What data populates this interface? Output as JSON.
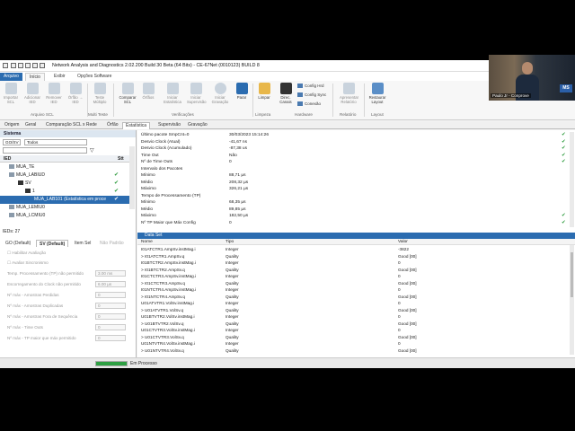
{
  "window": {
    "title": "Network Analysis and Diagnostics 2.02.200 Build 30 Beta (64 Bits) - CE-67Net (0010123)  BUILD 8"
  },
  "ribbon_tabs": [
    "Arquivo",
    "Início",
    "Exibir",
    "Opções Software"
  ],
  "ribbon": {
    "buttons": [
      {
        "label": "Importar SCL"
      },
      {
        "label": "Adicionar IED"
      },
      {
        "label": "Remover IED"
      },
      {
        "label": "Órfão → IED"
      },
      {
        "label": "Teste Múltiplo"
      },
      {
        "label": "Comparar SCL"
      },
      {
        "label": "Órfãos"
      },
      {
        "label": "Iniciar Estatística"
      },
      {
        "label": "Iniciar Supervisão"
      },
      {
        "label": "Iniciar Gravação"
      },
      {
        "label": "Parar"
      },
      {
        "label": "Limpar"
      },
      {
        "label": "Direc. Canais"
      },
      {
        "label": "Apresentar Relatório"
      },
      {
        "label": "Restaurar Layout"
      }
    ],
    "small_buttons": [
      "Config Hrd",
      "Config Sync",
      "Conexão"
    ],
    "groups": [
      "Arquivo SCL",
      "Multi Teste",
      "Verificações",
      "Limpeza",
      "Hardware",
      "Relatório",
      "Layout"
    ]
  },
  "doc_tabs": [
    "Origem",
    "Geral",
    "Comparação SCL x Rede",
    "Órfão",
    "Estatística",
    "Supervisão",
    "Gravação"
  ],
  "left": {
    "header": "Sistema",
    "filter1": "GO/SV",
    "filter2": "Todos",
    "col_ied": "IED",
    "col_stt": "Stt",
    "tree": [
      {
        "label": "MUA_TE",
        "indent": 1
      },
      {
        "label": "MUA_LABIUD",
        "indent": 1
      },
      {
        "label": "SV",
        "indent": 2
      },
      {
        "label": "1",
        "indent": 3
      },
      {
        "label": "MUA_LAB101 (Estatística em proce",
        "indent": 4,
        "selected": true
      },
      {
        "label": "MUA_LEMIU0",
        "indent": 1
      },
      {
        "label": "MUA_LCMIU0",
        "indent": 1
      }
    ],
    "ieds_count": "IEDs: 27",
    "prop_tabs": [
      "GO (Default)",
      "SV (Default)",
      "Item Sel",
      "Não Padrão"
    ],
    "props": [
      {
        "label": "Habilitar Avaliação",
        "value": ""
      },
      {
        "label": "Avaliar Sincronismo",
        "value": ""
      },
      {
        "label": "Temp. Processamento (TP) não permitido",
        "value": "3.00 ms"
      },
      {
        "label": "Escorregamento do Clock não permitido",
        "value": "6.00 µs"
      },
      {
        "label": "Nº máx - Amostras Perdidas",
        "value": "0"
      },
      {
        "label": "Nº máx - Amostras Duplicadas",
        "value": "0"
      },
      {
        "label": "Nº máx - Amostras Fora de Sequência",
        "value": "0"
      },
      {
        "label": "Nº máx - Time Outs",
        "value": "0"
      },
      {
        "label": "Nº máx - TP maior que máx permitido",
        "value": "0"
      }
    ]
  },
  "stats": [
    {
      "label": "Último pacote SmpCnt=0",
      "value": "30/03/2023 15:14:26",
      "ok": true
    },
    {
      "label": "Desvio Clock (Atual)",
      "value": "-41,67 ns",
      "ok": true
    },
    {
      "label": "Desvio Clock (Acumulado)",
      "value": "-87,38 us",
      "ok": true
    },
    {
      "label": "Time Out",
      "value": "Não",
      "ok": true
    },
    {
      "label": "Nº de Time Outs",
      "value": "0",
      "ok": true
    },
    {
      "label": "Intervalo dos Pacotes",
      "value": "",
      "ok": false
    },
    {
      "label": "   Mínimo",
      "value": "88,71 µs",
      "ok": false
    },
    {
      "label": "   Médio",
      "value": "208,32 µs",
      "ok": false
    },
    {
      "label": "   Máximo",
      "value": "326,21 µs",
      "ok": false
    },
    {
      "label": "Tempo de Processamento (TP)",
      "value": "",
      "ok": false
    },
    {
      "label": "   Mínimo",
      "value": "68,35 µs",
      "ok": false
    },
    {
      "label": "   Médio",
      "value": "89,85 µs",
      "ok": false
    },
    {
      "label": "   Máximo",
      "value": "182,50 µs",
      "ok": true
    },
    {
      "label": "Nº TP Maior que Máx Config",
      "value": "0",
      "ok": true
    }
  ],
  "dataset": {
    "header": "Data Set",
    "columns": [
      "Nome",
      "Tipo",
      "Valor"
    ],
    "rows": [
      [
        "I01ATCTR1.AmpSv.instMag.i",
        "Integer",
        "-3822"
      ],
      [
        "> I01ATCTR1.AmpSv.q",
        "Quality",
        "Good [00]"
      ],
      [
        "I01BTCTR2.AmpSv.instMag.i",
        "Integer",
        "0"
      ],
      [
        "> I01BTCTR2.AmpSv.q",
        "Quality",
        "Good [00]"
      ],
      [
        "I01CTCTR3.AmpSv.instMag.i",
        "Integer",
        "0"
      ],
      [
        "> I01CTCTR3.AmpSv.q",
        "Quality",
        "Good [00]"
      ],
      [
        "I01NTCTR4.AmpSv.instMag.i",
        "Integer",
        "0"
      ],
      [
        "> I01NTCTR4.AmpSv.q",
        "Quality",
        "Good [00]"
      ],
      [
        "U01ATVTR1.VolSv.instMag.i",
        "Integer",
        "0"
      ],
      [
        "> U01ATVTR1.VolSv.q",
        "Quality",
        "Good [00]"
      ],
      [
        "U01BTVTR2.VolSv.instMag.i",
        "Integer",
        "0"
      ],
      [
        "> U01BTVTR2.VolSv.q",
        "Quality",
        "Good [00]"
      ],
      [
        "U01CTVTR3.VolSv.instMag.i",
        "Integer",
        "0"
      ],
      [
        "> U01CTVTR3.VolSv.q",
        "Quality",
        "Good [00]"
      ],
      [
        "U01NTVTR4.VolSv.instMag.i",
        "Integer",
        "0"
      ],
      [
        "> U01NTVTR4.VolSv.q",
        "Quality",
        "Good [00]"
      ]
    ]
  },
  "status": {
    "text": "Em Processo",
    "progress": 1.0
  },
  "webcam": {
    "label": "Paulo Jr - Conprove",
    "logo": "MS"
  },
  "colors": {
    "accent": "#2b6cb0",
    "ok": "#2a9a3a",
    "progress": "#2ea043"
  }
}
